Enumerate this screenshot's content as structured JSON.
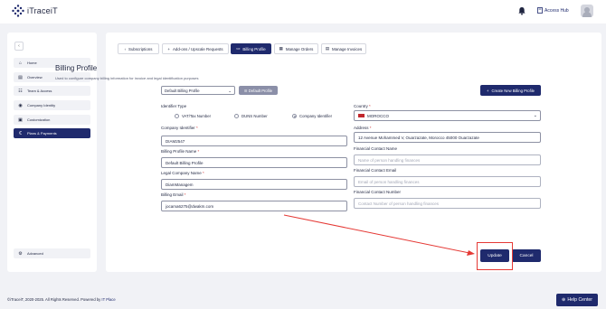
{
  "app": {
    "name": "iTraceiT"
  },
  "header": {
    "access_hub": "Access Hub"
  },
  "sidebar": {
    "items": [
      {
        "label": "Home",
        "icon": "home-icon"
      },
      {
        "label": "Overview",
        "icon": "overview-icon"
      },
      {
        "label": "Team & Access",
        "icon": "team-icon"
      },
      {
        "label": "Company Identity",
        "icon": "company-icon"
      },
      {
        "label": "Customization",
        "icon": "customization-icon"
      },
      {
        "label": "Plans & Payments",
        "icon": "plans-icon",
        "active": true
      }
    ],
    "advanced": "Advanced"
  },
  "tabs": [
    {
      "label": "Subscriptions",
      "prefix": "‹"
    },
    {
      "label": "Add-ons / Upscale Requests",
      "prefix": "+"
    },
    {
      "label": "Billing Profile",
      "prefix": "▭",
      "active": true
    },
    {
      "label": "Manage Orders",
      "prefix": "▦"
    },
    {
      "label": "Manage Invoices",
      "prefix": "▤"
    }
  ],
  "billing": {
    "title": "Billing Profile",
    "subtitle": "Used to configure company billing information for invoice and legal identification purposes",
    "profile_select": "Default Billing Profile",
    "default_button": "☰ Default Profile",
    "new_button": "Create New Billing Profile"
  },
  "form": {
    "identifier_type_label": "Identifier Type",
    "radio_options": [
      "VAT/Tax Number",
      "DUNS Number",
      "Company Identifier"
    ],
    "selected_radio": "Company Identifier",
    "company_identifier_label": "Company Identifier",
    "company_identifier_value": "DIAM2547",
    "profile_name_label": "Billing Profile Name",
    "profile_name_value": "Default Billing Profile",
    "legal_name_label": "Legal Company Name",
    "legal_name_value": "DiamManagem",
    "billing_email_label": "Billing Email",
    "billing_email_value": "jocama6275@dwakm.com",
    "country_label": "Country",
    "country_value": "MOROCCO",
    "address_label": "Address",
    "address_value": "12 Avenue Mohammed V, Ouarzazate, Morocco 45000 Ouarzazate",
    "contact_name_label": "Financial Contact Name",
    "contact_name_placeholder": "Name of person handling finances",
    "contact_email_label": "Financial Contact Email",
    "contact_email_placeholder": "Email of person handling finances",
    "contact_number_label": "Financial Contact Number",
    "contact_number_placeholder": "Contact Number of person handling finances",
    "required_mark": "*"
  },
  "actions": {
    "update": "Update",
    "cancel": "Cancel"
  },
  "footer": {
    "copyright": "©iTraceiT, 2020-2025. All Rights Reserved. Powered by",
    "powered": "IT Place",
    "help": "Help Center"
  },
  "colors": {
    "primary": "#1f2a6d",
    "annotation": "#e53935",
    "flag": "#c1272d"
  }
}
